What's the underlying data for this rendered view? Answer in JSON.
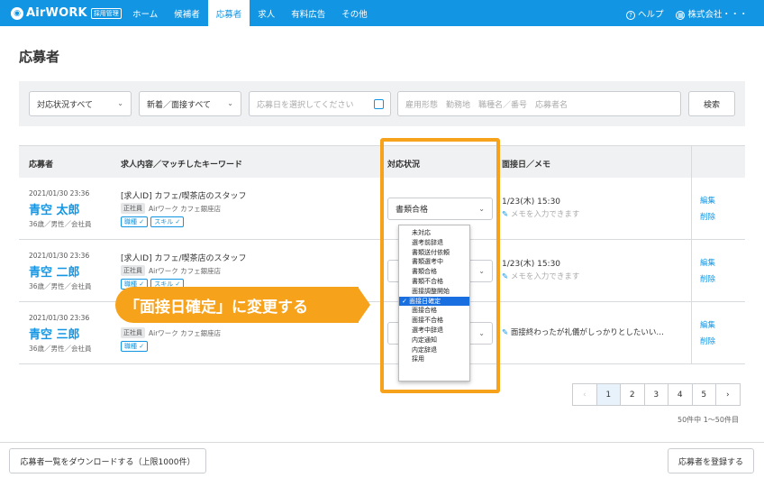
{
  "header": {
    "logo_text": "AirWORK",
    "logo_badge": "採用管理",
    "nav": [
      "ホーム",
      "候補者",
      "応募者",
      "求人",
      "有料広告",
      "その他"
    ],
    "active_nav": "応募者",
    "help": "ヘルプ",
    "company": "株式会社・・・"
  },
  "page": {
    "title": "応募者"
  },
  "filters": {
    "status": "対応状況すべて",
    "type": "新着／面接すべて",
    "date_placeholder": "応募日を選択してください",
    "keyword_placeholder": "雇用形態　勤務地　職種名／番号　応募者名",
    "search_button": "検索"
  },
  "table": {
    "headers": {
      "applicant": "応募者",
      "job": "求人内容／マッチしたキーワード",
      "status": "対応状況",
      "interview": "面接日／メモ"
    },
    "rows": [
      {
        "date": "2021/01/30 23:36",
        "name": "青空 太郎",
        "meta": "36歳／男性／会社員",
        "job": "[求人ID] カフェ/喫茶店のスタッフ",
        "employment": "正社員",
        "store": "Airワーク カフェ銀座店",
        "keywords": [
          "職種",
          "スキル"
        ],
        "status": "書類合格",
        "interview": "1/23(木) 15:30",
        "memo": "メモを入力できます",
        "edit": "編集",
        "delete": "削除"
      },
      {
        "date": "2021/01/30 23:36",
        "name": "青空 二郎",
        "meta": "36歳／男性／会社員",
        "job": "[求人ID] カフェ/喫茶店のスタッフ",
        "employment": "正社員",
        "store": "Airワーク カフェ銀座店",
        "keywords": [
          "職種",
          "スキル"
        ],
        "status": "",
        "interview": "1/23(木) 15:30",
        "memo": "メモを入力できます",
        "edit": "編集",
        "delete": "削除"
      },
      {
        "date": "2021/01/30 23:36",
        "name": "青空 三郎",
        "meta": "36歳／男性／会社員",
        "job": "",
        "employment": "正社員",
        "store": "Airワーク カフェ銀座店",
        "keywords": [
          "職種"
        ],
        "status": "",
        "interview": "",
        "memo": "面接終わったが礼儀がしっかりとしたいい…",
        "edit": "編集",
        "delete": "削除"
      }
    ]
  },
  "dropdown": {
    "options": [
      "未対応",
      "選考前辞退",
      "書類送付依頼",
      "書類選考中",
      "書類合格",
      "書類不合格",
      "面接調整開始",
      "面接日確定",
      "面接合格",
      "面接不合格",
      "選考中辞退",
      "内定通知",
      "内定辞退",
      "採用"
    ],
    "selected": "面接日確定"
  },
  "callout": "「面接日確定」に変更する",
  "pagination": {
    "pages": [
      "1",
      "2",
      "3",
      "4",
      "5"
    ],
    "current": "1",
    "count": "50件中 1〜50件目"
  },
  "footer": {
    "download": "応募者一覧をダウンロードする（上限1000件）",
    "register": "応募者を登録する"
  },
  "colors": {
    "brand": "#1296e3",
    "highlight": "#f7a21b",
    "selected_option": "#1a6fe0"
  }
}
